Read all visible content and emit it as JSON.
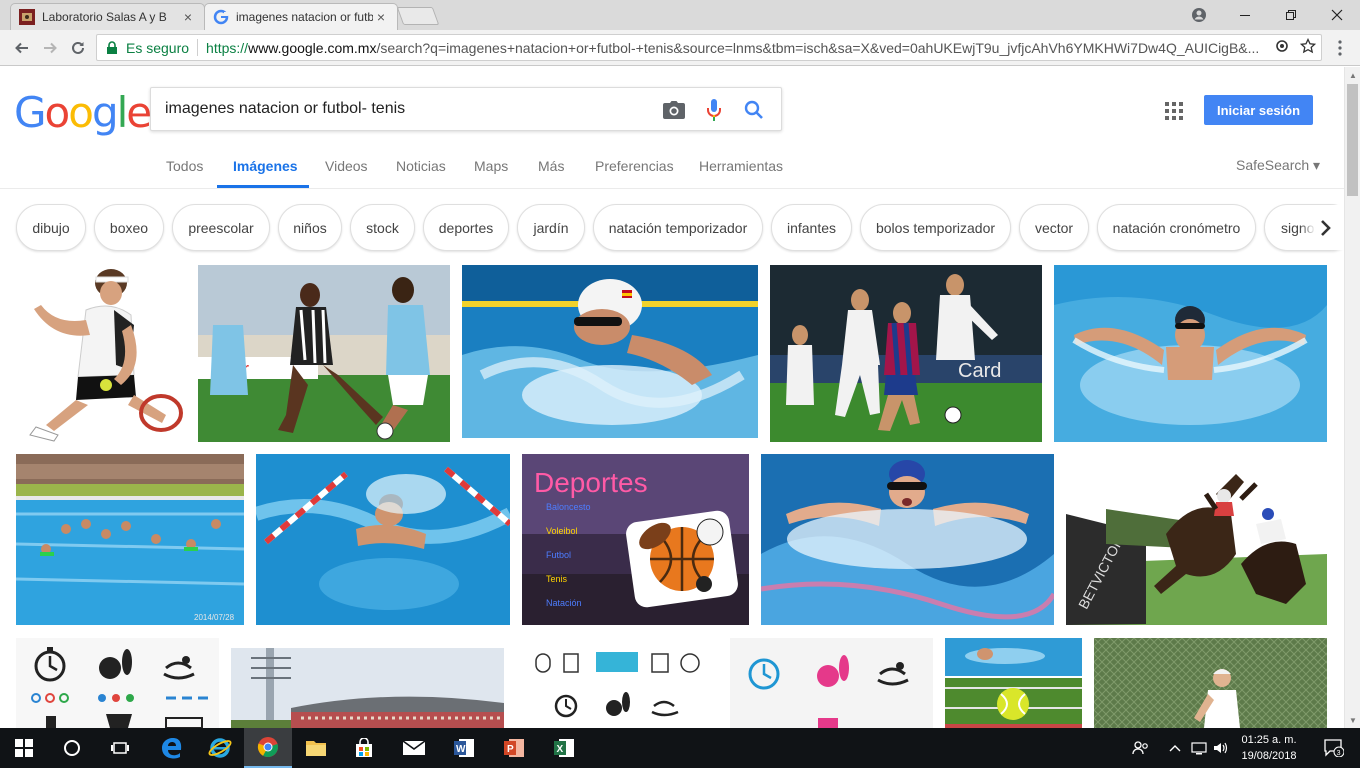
{
  "browser": {
    "tabs": [
      {
        "title": "Laboratorio Salas A y B",
        "close": "×"
      },
      {
        "title": "imagenes natacion or futbol- tenis",
        "close": "×"
      }
    ],
    "secure_label": "Es seguro",
    "url_scheme": "https://",
    "url_host": "www.google.com.mx",
    "url_path": "/search?q=imagenes+natacion+or+futbol-+tenis&source=lnms&tbm=isch&sa=X&ved=0ahUKEwjT9u_jvfjcAhVh6YMKHWi7Dw4Q_AUICigB&..."
  },
  "google": {
    "logo_letters": [
      "G",
      "o",
      "o",
      "g",
      "l",
      "e"
    ],
    "logo_colors": [
      "#4285f4",
      "#ea4335",
      "#fbbc05",
      "#4285f4",
      "#34a853",
      "#ea4335"
    ],
    "search_value": "imagenes natacion or futbol- tenis",
    "signin_label": "Iniciar sesión",
    "nav": {
      "todos": "Todos",
      "imagenes": "Imágenes",
      "videos": "Videos",
      "noticias": "Noticias",
      "maps": "Maps",
      "mas": "Más",
      "preferencias": "Preferencias",
      "herramientas": "Herramientas"
    },
    "safesearch": "SafeSearch ▾",
    "chips": [
      "dibujo",
      "boxeo",
      "preescolar",
      "niños",
      "stock",
      "deportes",
      "jardín",
      "natación temporizador",
      "infantes",
      "bolos temporizador",
      "vector",
      "natación cronómetro",
      "signos"
    ]
  },
  "thumb_text": {
    "deportes_title": "Deportes",
    "deportes_list": [
      "Baloncesto",
      "Voleibol",
      "Futbol",
      "Tenis",
      "Natación"
    ],
    "pool_stamp": "2014/07/28"
  },
  "taskbar": {
    "time": "01:25 a. m.",
    "date": "19/08/2018",
    "notification_count": "3"
  }
}
